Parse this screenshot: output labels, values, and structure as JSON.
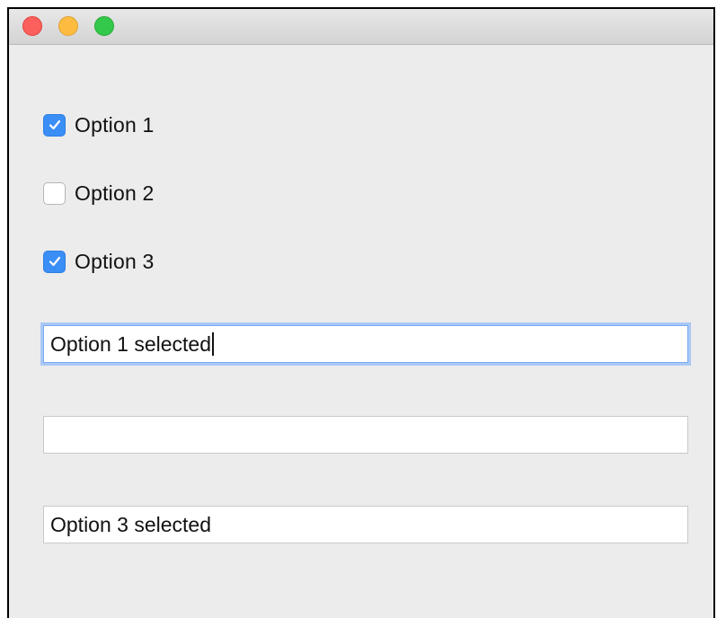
{
  "window": {
    "controls": [
      "close",
      "minimize",
      "zoom"
    ],
    "colors": {
      "close": "#fc605c",
      "minimize": "#fdbc40",
      "zoom": "#34c84a",
      "checkbox_accent": "#3a8ef6",
      "focus_ring": "#a9c8f5"
    }
  },
  "checkboxes": [
    {
      "label": "Option 1",
      "checked": true
    },
    {
      "label": "Option 2",
      "checked": false
    },
    {
      "label": "Option 3",
      "checked": true
    }
  ],
  "text_fields": [
    {
      "value": "Option 1 selected",
      "focused": true
    },
    {
      "value": "",
      "focused": false
    },
    {
      "value": "Option 3 selected",
      "focused": false
    }
  ]
}
